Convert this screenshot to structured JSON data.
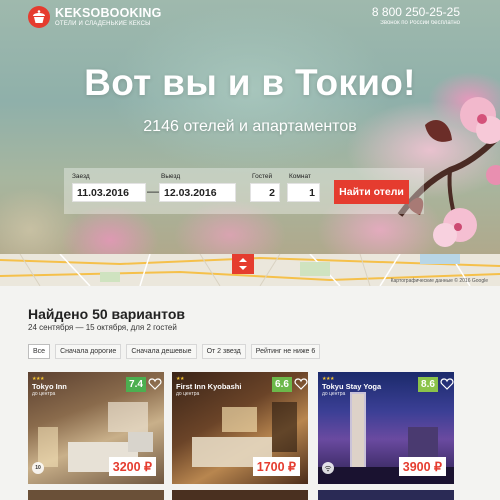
{
  "brand": {
    "name": "KEKSOBOOKING",
    "tagline": "ОТЕЛИ И СЛАДЕНЬКИЕ КЕКСЫ"
  },
  "contact": {
    "phone": "8 800 250-25-25",
    "note": "Звонок по России бесплатно"
  },
  "hero": {
    "title": "Вот вы и в Токио!",
    "subtitle": "2146 отелей и апартаментов"
  },
  "search": {
    "checkin_label": "Заезд",
    "checkin_value": "11.03.2016",
    "checkout_label": "Выезд",
    "checkout_value": "12.03.2016",
    "separator": "—",
    "guests_label": "Гостей",
    "guests_value": "2",
    "rooms_label": "Комнат",
    "rooms_value": "1",
    "submit_label": "Найти отели"
  },
  "map": {
    "copyright": "Картографические данные © 2016 Google"
  },
  "results": {
    "found_text": "Найдено 50 вариантов",
    "dates_text": "24 сентября — 15 октября, для 2 гостей",
    "filters": [
      "Все",
      "Сначала дорогие",
      "Сначала дешевые",
      "От 2 звезд",
      "Рейтинг не ниже 6"
    ],
    "active_filter": "Все",
    "hotels": [
      {
        "name": "Tokyo Inn",
        "stars": "★★★",
        "distance": "до центра",
        "rating": "7.4",
        "price": "3200 ₽",
        "badge": "10"
      },
      {
        "name": "First Inn Kyobashi",
        "stars": "★★",
        "distance": "до центра",
        "rating": "6.6",
        "price": "1700 ₽",
        "badge": ""
      },
      {
        "name": "Tokyu Stay Yoga",
        "stars": "★★★",
        "distance": "до центра",
        "rating": "8.6",
        "price": "3900 ₽",
        "badge": ""
      }
    ]
  },
  "colors": {
    "accent": "#e53c2f",
    "rating": "#4caf50",
    "star": "#f4c431"
  },
  "icons": [
    "cupcake-icon",
    "map-toggle-icon",
    "heart-icon",
    "wifi-icon",
    "award-icon"
  ]
}
